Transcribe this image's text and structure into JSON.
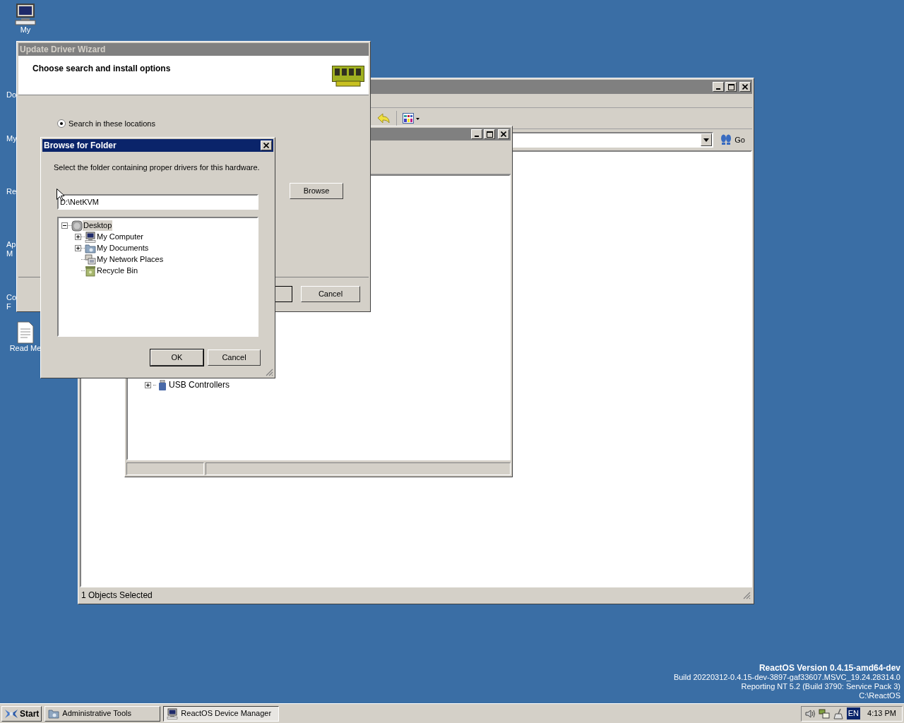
{
  "desktop": {
    "icons": [
      {
        "kind": "computer",
        "lines": [
          "My"
        ]
      },
      {
        "kind": "none",
        "lines": [
          "Do"
        ]
      },
      {
        "kind": "none",
        "lines": [
          "My"
        ]
      },
      {
        "kind": "none",
        "lines": [
          "Re"
        ]
      },
      {
        "kind": "none",
        "lines": [
          "Ap",
          "M"
        ]
      },
      {
        "kind": "none",
        "lines": [
          "Co",
          "F"
        ]
      },
      {
        "kind": "text-file",
        "lines": [
          "Read Me"
        ]
      }
    ]
  },
  "explorer_window": {
    "go_label": "Go",
    "status_text": "1 Objects Selected"
  },
  "device_manager": {
    "tree": [
      {
        "label": "USB Controllers",
        "expanded": false
      }
    ]
  },
  "wizard": {
    "title": "Update Driver Wizard",
    "heading": "Choose search and install options",
    "radio": {
      "label": "Search in these locations",
      "selected": true
    },
    "browse_button": "Browse",
    "cancel_button": "Cancel"
  },
  "browse_dialog": {
    "title": "Browse for Folder",
    "prompt": "Select the folder containing proper drivers for this hardware.",
    "path": "D:\\NetKVM",
    "tree": [
      {
        "label": "Desktop",
        "kind": "desktop",
        "has_children": true,
        "expanded": true,
        "selected": true,
        "children": [
          {
            "label": "My Computer",
            "kind": "computer",
            "has_children": true,
            "selected": false
          },
          {
            "label": "My Documents",
            "kind": "documents",
            "has_children": true,
            "selected": false
          },
          {
            "label": "My Network Places",
            "kind": "network",
            "has_children": false,
            "selected": false
          },
          {
            "label": "Recycle Bin",
            "kind": "recycle-bin",
            "has_children": false,
            "selected": false
          }
        ]
      }
    ],
    "ok_button": "OK",
    "cancel_button": "Cancel"
  },
  "version_info": {
    "heading": "ReactOS Version 0.4.15-amd64-dev",
    "lines": [
      "Build 20220312-0.4.15-dev-3897-gaf33607.MSVC_19.24.28314.0",
      "Reporting NT 5.2 (Build 3790: Service Pack 3)",
      "C:\\ReactOS"
    ]
  },
  "taskbar": {
    "start_label": "Start",
    "tasks": [
      {
        "label": "Administrative Tools",
        "kind": "folder",
        "selected": false
      },
      {
        "label": "ReactOS Device Manager",
        "kind": "computer",
        "selected": true
      }
    ],
    "language": "EN",
    "clock": "4:13 PM"
  }
}
